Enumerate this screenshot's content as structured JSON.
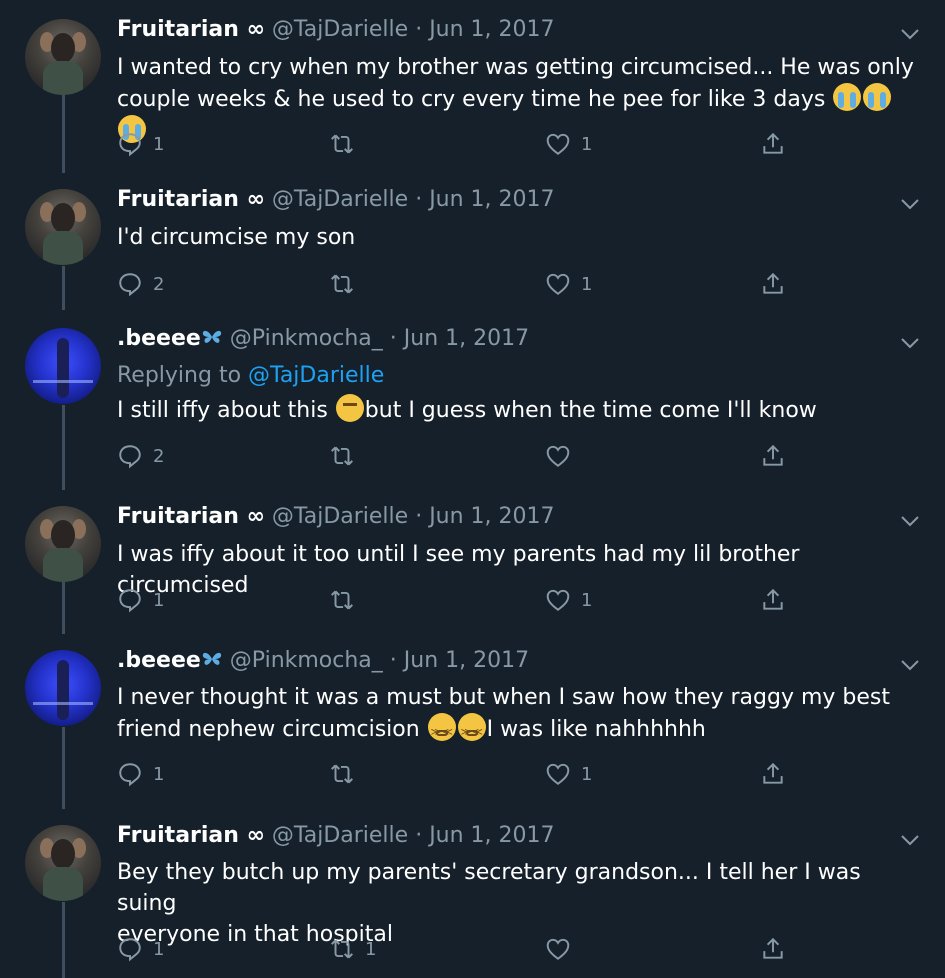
{
  "tweets": [
    {
      "name": "Fruitarian ∞",
      "handle": "@TajDarielle",
      "date": "Jun 1, 2017",
      "avatar": "taj",
      "replying_to": "",
      "text_parts": [
        "I wanted to cry when my brother was getting circumcised... He was only",
        "couple weeks & he used to cry every time he pee for like 3 days"
      ],
      "emojis": [
        "loudly-crying-face",
        "loudly-crying-face",
        "loudly-crying-face"
      ],
      "reply_count": "1",
      "retweet_count": "",
      "like_count": "1"
    },
    {
      "name": "Fruitarian ∞",
      "handle": "@TajDarielle",
      "date": "Jun 1, 2017",
      "avatar": "taj",
      "replying_to": "",
      "text_parts": [
        "I'd circumcise my son"
      ],
      "emojis": [],
      "reply_count": "2",
      "retweet_count": "",
      "like_count": "1"
    },
    {
      "name": ".beeee",
      "handle": "@Pinkmocha_",
      "date": "Jun 1, 2017",
      "avatar": "bee",
      "name_emoji": "butterfly",
      "replying_label": "Replying to",
      "replying_to": "@TajDarielle",
      "text_parts": [
        "I still iffy about this",
        "but I guess when the time come I'll know"
      ],
      "emojis": [
        "thinking-face"
      ],
      "reply_count": "2",
      "retweet_count": "",
      "like_count": ""
    },
    {
      "name": "Fruitarian ∞",
      "handle": "@TajDarielle",
      "date": "Jun 1, 2017",
      "avatar": "taj",
      "replying_to": "",
      "text_parts": [
        "I was iffy about it too until I see my parents had my lil brother circumcised"
      ],
      "emojis": [],
      "reply_count": "1",
      "retweet_count": "",
      "like_count": "1"
    },
    {
      "name": ".beeee",
      "handle": "@Pinkmocha_",
      "date": "Jun 1, 2017",
      "avatar": "bee",
      "name_emoji": "butterfly",
      "replying_to": "",
      "text_parts": [
        "I never thought it was a must but when I saw how they raggy my best",
        "friend nephew circumcision",
        "I was like nahhhhhh"
      ],
      "emojis": [
        "tired-face",
        "tired-face"
      ],
      "reply_count": "1",
      "retweet_count": "",
      "like_count": "1"
    },
    {
      "name": "Fruitarian ∞",
      "handle": "@TajDarielle",
      "date": "Jun 1, 2017",
      "avatar": "taj",
      "replying_to": "",
      "text_parts": [
        "Bey they butch up my parents' secretary grandson... I tell her I was suing",
        "everyone in that hospital"
      ],
      "emojis": [],
      "reply_count": "1",
      "retweet_count": "1",
      "like_count": ""
    }
  ],
  "separator": "·",
  "colors": {
    "background": "#15202b",
    "text": "#ffffff",
    "muted": "#8899a6",
    "link": "#1da1f2",
    "thread_line": "#3d4f5e"
  },
  "icons": [
    "reply-icon",
    "retweet-icon",
    "like-icon",
    "share-icon",
    "caret-down-icon"
  ]
}
